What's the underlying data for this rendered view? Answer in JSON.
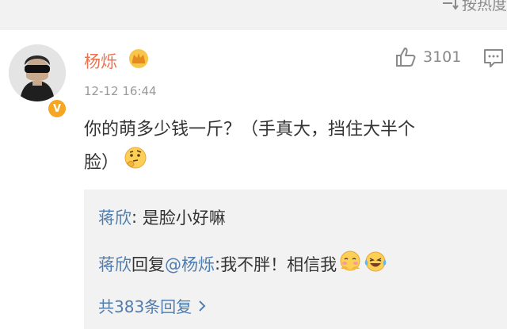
{
  "header": {
    "sort_label": "按热度",
    "sort_icon": "sort-lines-icon"
  },
  "comment": {
    "username": "杨烁",
    "username_color": "#eb7350",
    "badge_icon": "crown-vip-icon",
    "verified_icon": "verified-v-icon",
    "verified_mark": "V",
    "time": "12-12 16:44",
    "likes": "3101",
    "like_icon": "thumbs-up-icon",
    "reply_icon": "comment-bubble-icon",
    "text_line1": "你的萌多少钱一斤？（手真大，挡住大半个",
    "text_line2": "脸）",
    "text_emoji": "thinking-face-emoji"
  },
  "replies": {
    "items": [
      {
        "author": "蒋欣",
        "separator": ": ",
        "text": "是脸小好嘛"
      },
      {
        "author": "蒋欣",
        "reply_word": "回复",
        "mention": "@杨烁",
        "separator": ":",
        "text": "我不胖！相信我",
        "emojis": [
          "shy-face-emoji",
          "laughing-tears-emoji"
        ]
      }
    ],
    "more_label": "共383条回复",
    "more_icon": "chevron-right-icon",
    "link_color": "#507daf"
  }
}
